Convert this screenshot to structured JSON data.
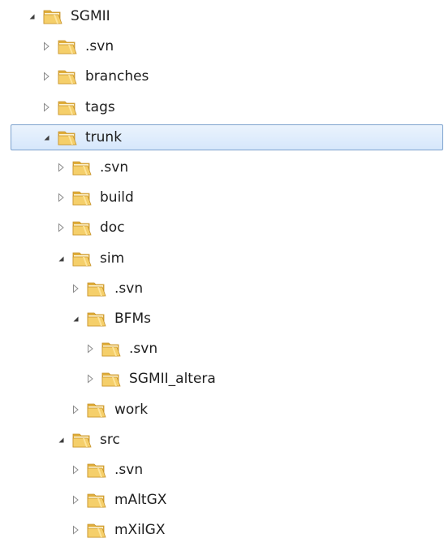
{
  "tree": [
    {
      "label": "SGMII",
      "level": 0,
      "expanded": true,
      "icon": "folder-icon"
    },
    {
      "label": ".svn",
      "level": 1,
      "expanded": false,
      "icon": "folder-icon"
    },
    {
      "label": "branches",
      "level": 1,
      "expanded": false,
      "icon": "folder-icon"
    },
    {
      "label": "tags",
      "level": 1,
      "expanded": false,
      "icon": "folder-icon"
    },
    {
      "label": "trunk",
      "level": 1,
      "expanded": true,
      "selected": true,
      "icon": "folder-icon"
    },
    {
      "label": ".svn",
      "level": 2,
      "expanded": false,
      "icon": "folder-icon"
    },
    {
      "label": "build",
      "level": 2,
      "expanded": false,
      "icon": "folder-icon"
    },
    {
      "label": "doc",
      "level": 2,
      "expanded": false,
      "icon": "folder-icon"
    },
    {
      "label": "sim",
      "level": 2,
      "expanded": true,
      "icon": "folder-icon"
    },
    {
      "label": ".svn",
      "level": 3,
      "expanded": false,
      "icon": "folder-icon"
    },
    {
      "label": "BFMs",
      "level": 3,
      "expanded": true,
      "icon": "folder-icon"
    },
    {
      "label": ".svn",
      "level": 4,
      "expanded": false,
      "icon": "folder-icon"
    },
    {
      "label": "SGMII_altera",
      "level": 4,
      "expanded": false,
      "icon": "folder-icon"
    },
    {
      "label": "work",
      "level": 3,
      "expanded": false,
      "icon": "folder-icon"
    },
    {
      "label": "src",
      "level": 2,
      "expanded": true,
      "icon": "folder-icon"
    },
    {
      "label": ".svn",
      "level": 3,
      "expanded": false,
      "icon": "folder-icon"
    },
    {
      "label": "mAltGX",
      "level": 3,
      "expanded": false,
      "icon": "folder-icon"
    },
    {
      "label": "mXilGX",
      "level": 3,
      "expanded": false,
      "icon": "folder-icon"
    }
  ],
  "colors": {
    "folder_front": "#f5cf6a",
    "folder_back": "#e0ae3c",
    "folder_edge": "#c79227",
    "expander_collapsed": "#8c8c8c",
    "expander_expanded": "#3c3c3c",
    "selection_border": "#7da2ce"
  }
}
